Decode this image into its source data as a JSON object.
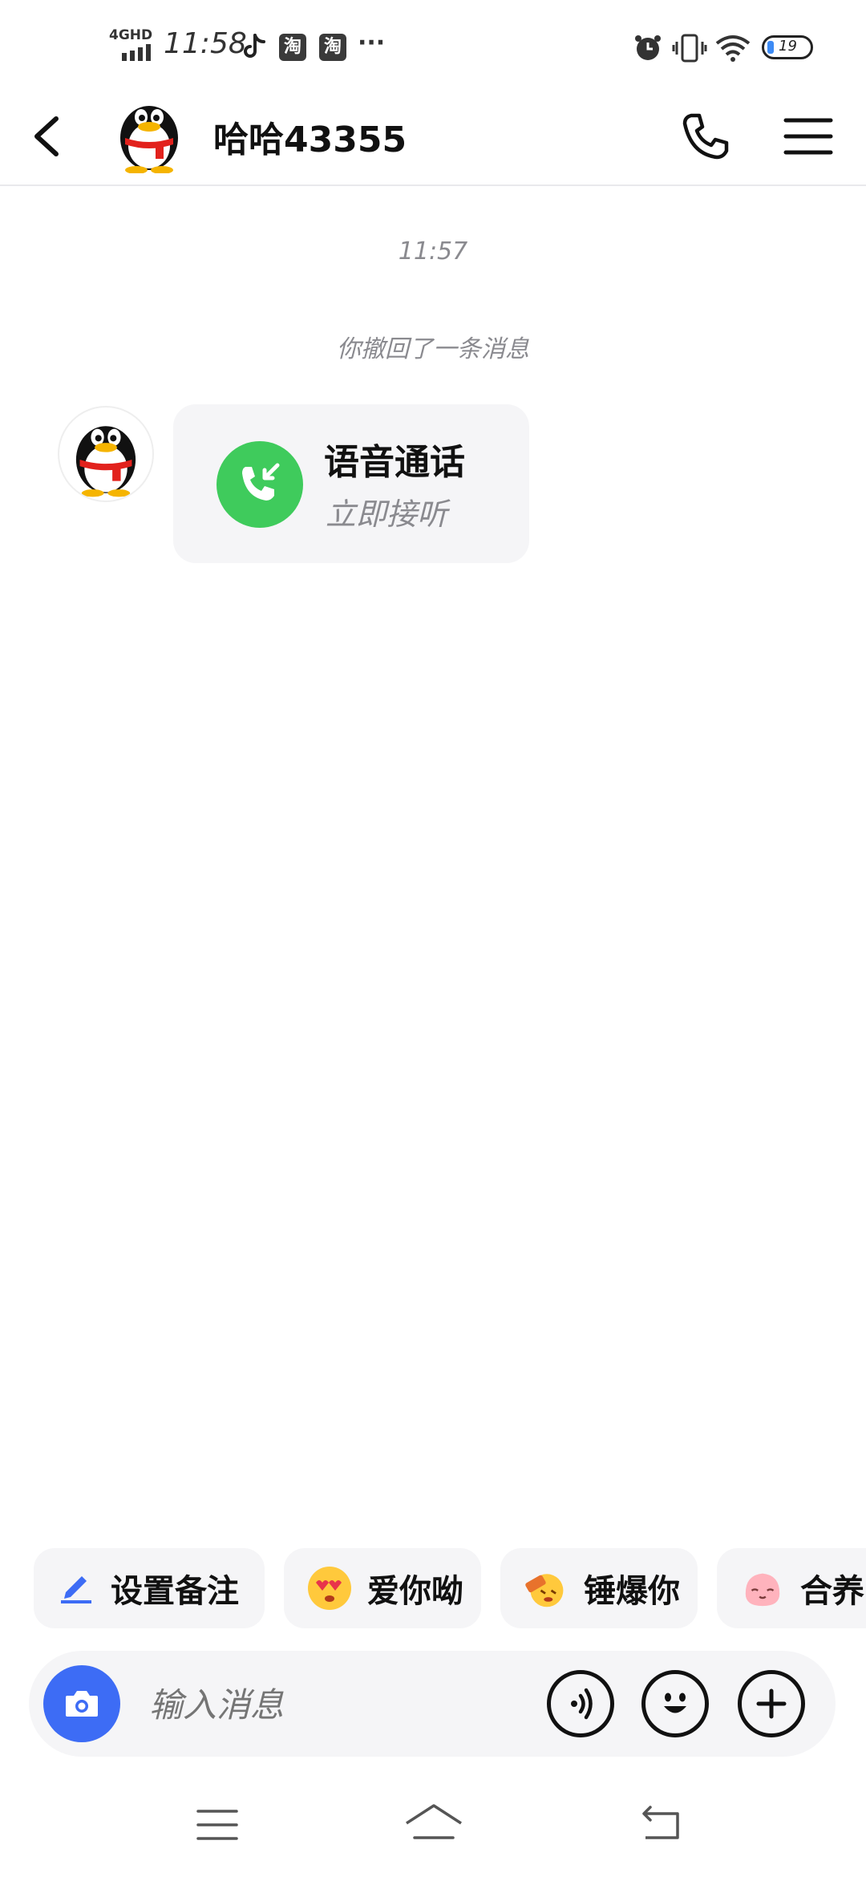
{
  "status_bar": {
    "network": "4GHD",
    "time": "11:58",
    "app_icons": [
      "tiktok-icon",
      "taobao-icon",
      "taobao-icon"
    ],
    "taobao_glyph": "淘",
    "more": "···",
    "battery": "19",
    "right_icons": [
      "alarm-icon",
      "vibrate-icon",
      "wifi-icon",
      "battery-icon"
    ]
  },
  "header": {
    "title": "哈哈43355"
  },
  "chat": {
    "timestamp": "11:57",
    "system_message": "你撤回了一条消息",
    "call_card": {
      "title": "语音通话",
      "subtitle": "立即接听",
      "accent": "#3fcb5c"
    }
  },
  "quick_chips": [
    {
      "label": "设置备注",
      "icon": "pencil-icon"
    },
    {
      "label": "爱你呦",
      "icon": "love-face-emoji"
    },
    {
      "label": "锤爆你",
      "icon": "hammer-face-emoji"
    },
    {
      "label": "合养",
      "icon": "peach-emoji"
    }
  ],
  "input_bar": {
    "placeholder": "输入消息",
    "camera_color": "#3d6cf5"
  },
  "colors": {
    "primary_text": "#111111",
    "secondary_text": "#8a8a8f",
    "surface": "#f5f5f7"
  }
}
